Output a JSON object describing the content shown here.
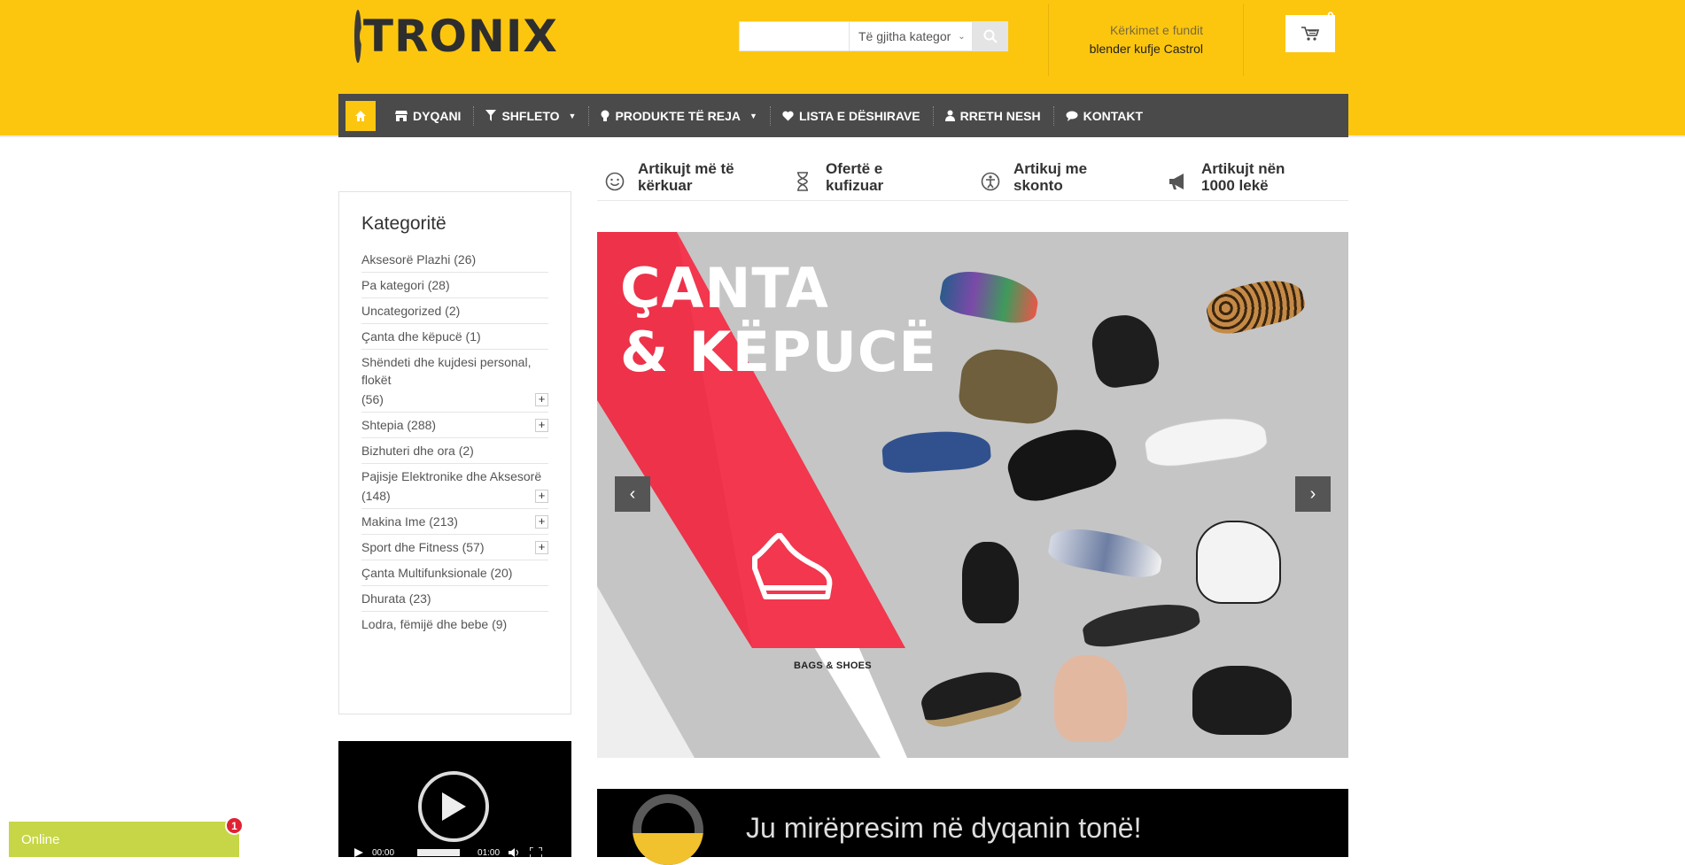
{
  "header": {
    "logo_text": "TRONIX",
    "search": {
      "placeholder": "",
      "category": "Të gjitha kategor"
    },
    "recent": {
      "label": "Kërkimet e fundit",
      "value": "blender kufje Castrol"
    },
    "cart_count": "0"
  },
  "nav": {
    "items": [
      {
        "label": "DYQANI",
        "icon": "store-icon"
      },
      {
        "label": "SHFLETO",
        "icon": "filter-icon",
        "caret": "▼"
      },
      {
        "label": "PRODUKTE TË REJA",
        "icon": "bulb-icon",
        "caret": "▼"
      },
      {
        "label": "LISTA E DËSHIRAVE",
        "icon": "heart-icon"
      },
      {
        "label": "RRETH NESH",
        "icon": "user-icon"
      },
      {
        "label": "KONTAKT",
        "icon": "chat-icon"
      }
    ]
  },
  "features": [
    {
      "label": "Artikujt më të kërkuar",
      "icon": "smile-icon"
    },
    {
      "label": "Ofertë e kufizuar",
      "icon": "hourglass-icon"
    },
    {
      "label": "Artikuj me skonto",
      "icon": "accessibility-icon"
    },
    {
      "label": "Artikujt nën 1000 lekë",
      "icon": "megaphone-icon"
    }
  ],
  "sidebar": {
    "title": "Kategoritë",
    "categories": [
      {
        "label": "Aksesorë Plazhi (26)"
      },
      {
        "label": "Pa kategori (28)"
      },
      {
        "label": "Uncategorized (2)"
      },
      {
        "label": "Çanta dhe këpucë (1)"
      },
      {
        "label": "Shëndeti dhe kujdesi personal, flokët",
        "label2": "(56)",
        "expand": "+"
      },
      {
        "label": "Shtepia (288)",
        "expand": "+"
      },
      {
        "label": "Bizhuteri dhe ora (2)"
      },
      {
        "label": "Pajisje Elektronike dhe Aksesorë",
        "label2": "(148)",
        "expand": "+"
      },
      {
        "label": "Makina Ime (213)",
        "expand": "+"
      },
      {
        "label": "Sport dhe Fitness (57)",
        "expand": "+"
      },
      {
        "label": "Çanta Multifunksionale (20)"
      },
      {
        "label": "Dhurata (23)"
      },
      {
        "label": "Lodra, fëmijë dhe bebe (9)"
      }
    ]
  },
  "slider": {
    "title_line1": "ÇANTA",
    "title_line2": "& KËPUCË",
    "subtitle": "BAGS & SHOES",
    "prev": "‹",
    "next": "›",
    "colors": {
      "bg": "#c5c5c5",
      "accent": "#f2374e"
    }
  },
  "video": {
    "time_current": "00:00",
    "time_total": "01:00"
  },
  "welcome": {
    "text": "Ju mirëpresim në dyqanin tonë!"
  },
  "chat": {
    "status": "Online",
    "badge": "1"
  },
  "colors": {
    "brand": "#fcc60f",
    "nav": "#4a4a4a"
  }
}
